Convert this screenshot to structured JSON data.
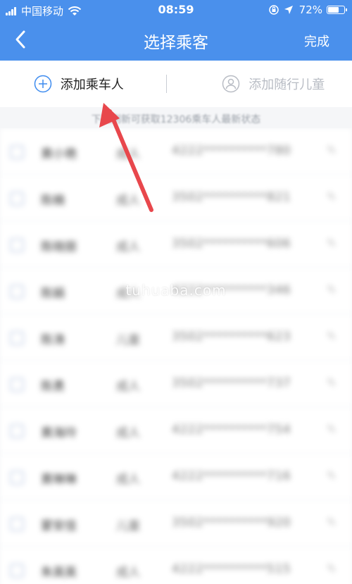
{
  "status_bar": {
    "carrier": "中国移动",
    "time": "08:59",
    "battery_text": "72%",
    "battery_level": 0.72
  },
  "nav": {
    "title": "选择乘客",
    "done_label": "完成",
    "back_icon": "chevron-left-icon"
  },
  "actions": {
    "add_passenger": "添加乘车人",
    "add_child": "添加随行儿童",
    "add_passenger_icon": "plus-circle-icon",
    "add_child_icon": "person-circle-icon"
  },
  "hint": "下拉刷新可获取12306乘车人最新状态",
  "passengers": [
    {
      "name": "黄小艳",
      "type": "成人",
      "id_no": "4222**********780"
    },
    {
      "name": "陈楠",
      "type": "成人",
      "id_no": "3502**********821"
    },
    {
      "name": "陈晓丽",
      "type": "成人",
      "id_no": "3502**********606"
    },
    {
      "name": "陈娟",
      "type": "成人",
      "id_no": "4222**********346"
    },
    {
      "name": "陈涛",
      "type": "儿童",
      "id_no": "3502**********623"
    },
    {
      "name": "陈勇",
      "type": "成人",
      "id_no": "3502**********737"
    },
    {
      "name": "黄海玲",
      "type": "成人",
      "id_no": "4222**********754"
    },
    {
      "name": "黄琳琳",
      "type": "成人",
      "id_no": "4222**********716"
    },
    {
      "name": "蒙安佳",
      "type": "儿童",
      "id_no": "3502**********920"
    },
    {
      "name": "朱英英",
      "type": "成人",
      "id_no": "4222**********515"
    }
  ],
  "watermark": "tuhuaba.com",
  "colors": {
    "header": "#4a90ec",
    "annotation_arrow": "#e8474c",
    "primary_icon": "#3d8bef",
    "secondary_icon": "#b8bcc4"
  }
}
